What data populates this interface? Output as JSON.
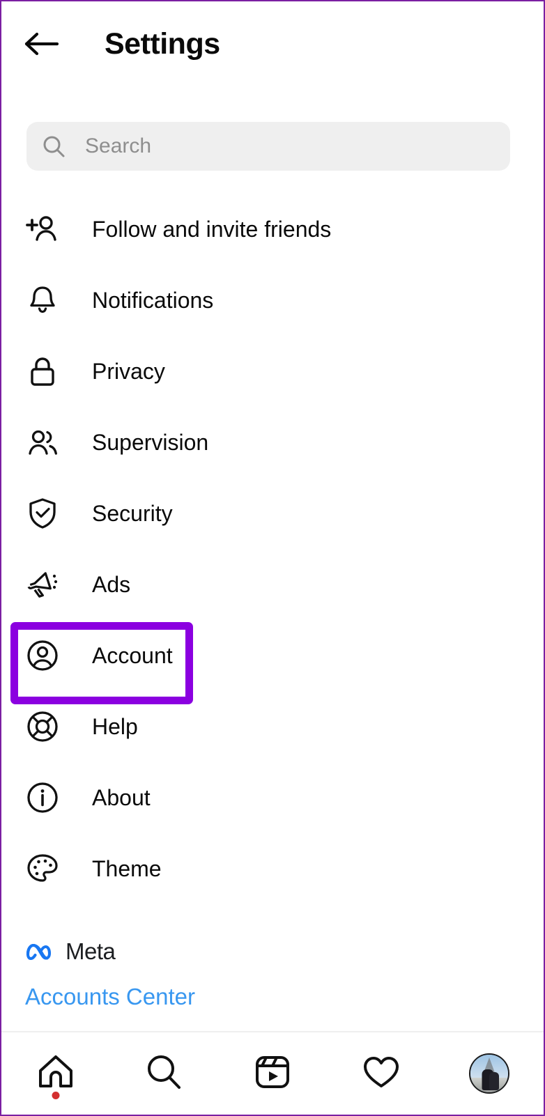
{
  "header": {
    "back_icon": "back-arrow-icon",
    "title": "Settings"
  },
  "search": {
    "icon": "search-icon",
    "placeholder": "Search",
    "value": ""
  },
  "menu": {
    "items": [
      {
        "label": "Follow and invite friends",
        "icon": "person-add-icon",
        "highlighted": false
      },
      {
        "label": "Notifications",
        "icon": "bell-icon",
        "highlighted": false
      },
      {
        "label": "Privacy",
        "icon": "lock-icon",
        "highlighted": false
      },
      {
        "label": "Supervision",
        "icon": "people-icon",
        "highlighted": false
      },
      {
        "label": "Security",
        "icon": "shield-check-icon",
        "highlighted": false
      },
      {
        "label": "Ads",
        "icon": "megaphone-icon",
        "highlighted": false
      },
      {
        "label": "Account",
        "icon": "account-circle-icon",
        "highlighted": true
      },
      {
        "label": "Help",
        "icon": "life-ring-icon",
        "highlighted": false
      },
      {
        "label": "About",
        "icon": "info-circle-icon",
        "highlighted": false
      },
      {
        "label": "Theme",
        "icon": "palette-icon",
        "highlighted": false
      }
    ]
  },
  "meta": {
    "logo_icon": "meta-infinity-logo-icon",
    "brand": "Meta",
    "accounts_center_link": "Accounts Center"
  },
  "bottom_nav": {
    "items": [
      {
        "name": "home",
        "icon": "home-icon",
        "has_badge": true
      },
      {
        "name": "search",
        "icon": "search-icon",
        "has_badge": false
      },
      {
        "name": "reels",
        "icon": "reels-icon",
        "has_badge": false
      },
      {
        "name": "likes",
        "icon": "heart-icon",
        "has_badge": false
      },
      {
        "name": "profile",
        "icon": "profile-avatar-icon",
        "has_badge": false
      }
    ]
  },
  "colors": {
    "highlight_purple": "#8B00E0",
    "link_blue": "#3897f0",
    "meta_logo_blue": "#1877f2",
    "search_bg": "#efefef",
    "badge_red": "#d32f2f",
    "frame_border": "#7B1FA2"
  }
}
